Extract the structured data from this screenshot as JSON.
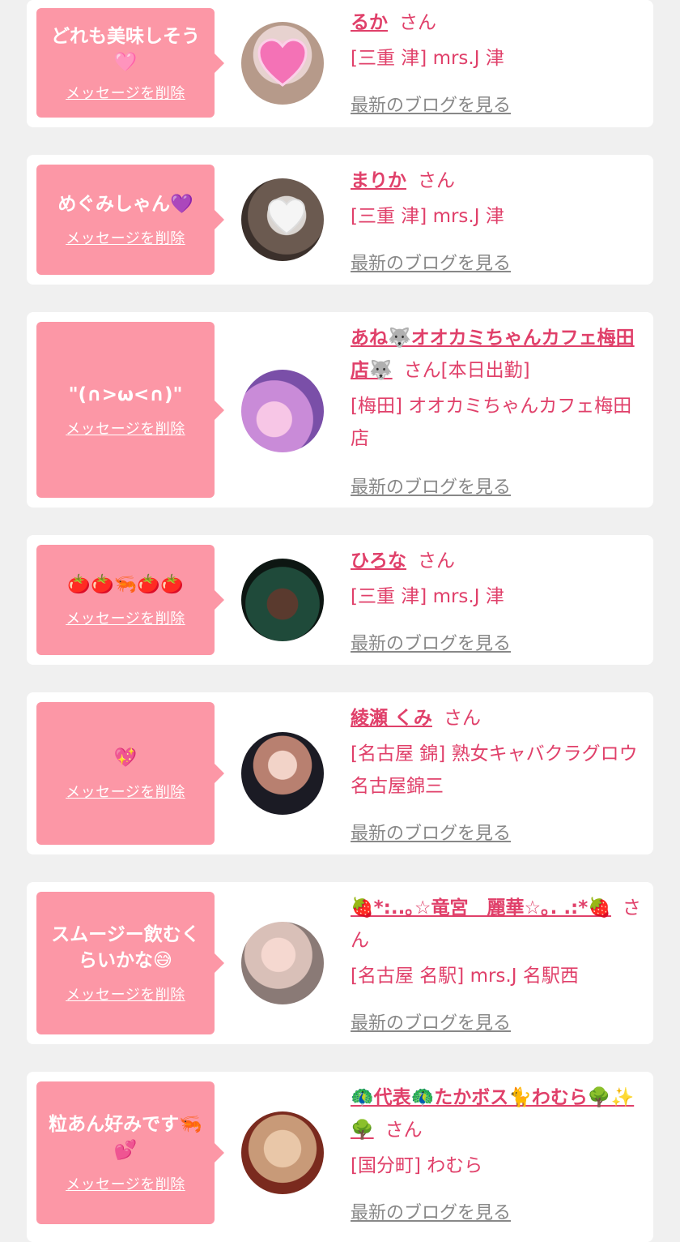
{
  "cards": [
    {
      "message": "どれも美味しそう🩷",
      "delete_label": "メッセージを削除",
      "name": "るか",
      "honorific": "さん",
      "shop": "[三重 津] mrs.J 津",
      "blog_link": "最新のブログを見る"
    },
    {
      "message": "めぐみしゃん💜",
      "delete_label": "メッセージを削除",
      "name": "まりか",
      "honorific": "さん",
      "shop": "[三重 津] mrs.J 津",
      "blog_link": "最新のブログを見る"
    },
    {
      "message": "\"(∩>ω<∩)\"",
      "delete_label": "メッセージを削除",
      "name": "あね🐺オオカミちゃんカフェ梅田店🐺",
      "honorific": "さん[本日出勤]",
      "shop": "[梅田] オオカミちゃんカフェ梅田店",
      "blog_link": "最新のブログを見る"
    },
    {
      "message": "🍅🍅🦐🍅🍅",
      "delete_label": "メッセージを削除",
      "name": "ひろな",
      "honorific": "さん",
      "shop": "[三重 津] mrs.J 津",
      "blog_link": "最新のブログを見る"
    },
    {
      "message": "💖",
      "delete_label": "メッセージを削除",
      "name": "綾瀬 くみ",
      "honorific": "さん",
      "shop": "[名古屋 錦] 熟女キャバクラグロウ 名古屋錦三",
      "blog_link": "最新のブログを見る"
    },
    {
      "message": "スムージー飲むくらいかな😅",
      "delete_label": "メッセージを削除",
      "name": "🍓*:..｡☆竜宮　麗華☆｡. .:*🍓",
      "honorific": "さん",
      "shop": "[名古屋 名駅] mrs.J 名駅西",
      "blog_link": "最新のブログを見る"
    },
    {
      "message": "粒あん好みです🦐💕",
      "delete_label": "メッセージを削除",
      "name": "🦚代表🦚たかボス🐈わむら🌳✨🌳",
      "honorific": "さん",
      "shop": "[国分町] わむら",
      "blog_link": "最新のブログを見る"
    }
  ],
  "colors": {
    "page_bg": "#f0f0f0",
    "card_bg": "#ffffff",
    "bubble": "#fc97a6",
    "accent": "#e0406a",
    "link_gray": "#888888"
  }
}
